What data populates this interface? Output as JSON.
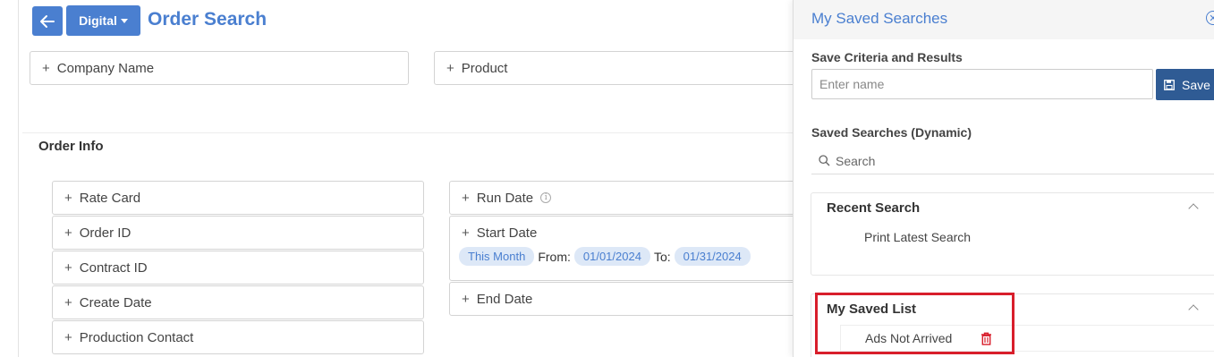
{
  "header": {
    "back_icon": "arrow-left-icon",
    "channel_dropdown": "Digital",
    "title": "Order Search"
  },
  "top_fields": {
    "company_name": "Company Name",
    "product": "Product"
  },
  "order_info": {
    "title": "Order Info",
    "left_fields": [
      "Rate Card",
      "Order ID",
      "Contract ID",
      "Create Date",
      "Production Contact"
    ],
    "run_date": "Run Date",
    "start_date": {
      "label": "Start Date",
      "preset": "This Month",
      "from_label": "From:",
      "from_value": "01/01/2024",
      "to_label": "To:",
      "to_value": "01/31/2024"
    },
    "end_date": "End Date"
  },
  "panel": {
    "title": "My Saved Searches",
    "save_section_label": "Save Criteria and Results",
    "name_placeholder": "Enter name",
    "save_button": "Save",
    "saved_dynamic_label": "Saved Searches (Dynamic)",
    "search_placeholder": "Search",
    "recent": {
      "title": "Recent Search",
      "items": [
        "Print Latest Search"
      ]
    },
    "my_saved_list": {
      "title": "My Saved List",
      "items": [
        "Ads Not Arrived"
      ]
    }
  },
  "colors": {
    "accent": "#4a7fd0",
    "save_button": "#2f5b94",
    "highlight": "#d81e2b",
    "delete_icon": "#d81e2b"
  }
}
